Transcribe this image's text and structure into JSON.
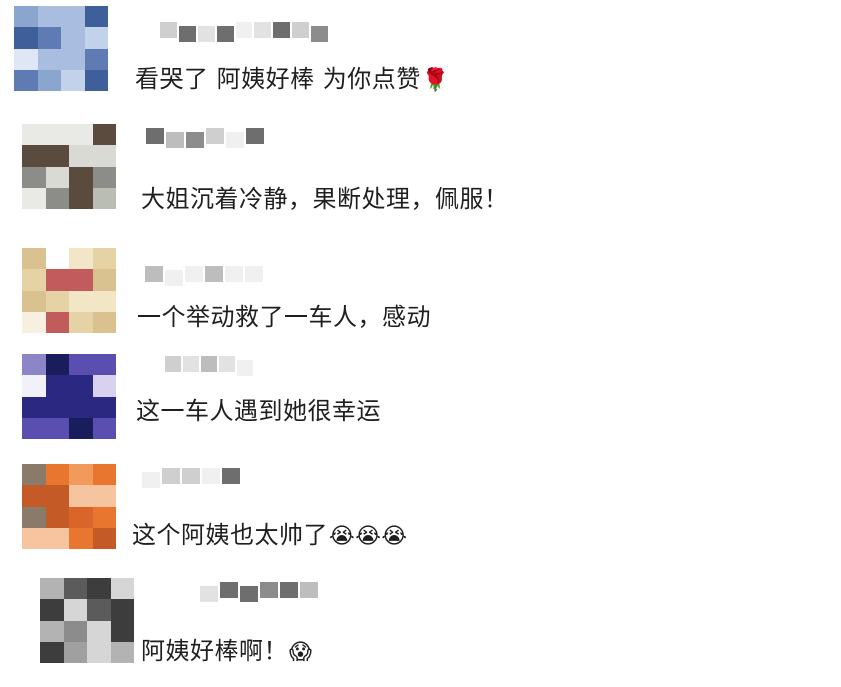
{
  "comments": [
    {
      "text": "看哭了 阿姨好棒 为你点赞",
      "emoji": "🌹",
      "emoji_icon": "rose-icon"
    },
    {
      "text": "大姐沉着冷静，果断处理，佩服！",
      "emoji": "",
      "emoji_icon": ""
    },
    {
      "text": "一个举动救了一车人，感动",
      "emoji": "",
      "emoji_icon": ""
    },
    {
      "text": "这一车人遇到她很幸运",
      "emoji": "",
      "emoji_icon": ""
    },
    {
      "text": "这个阿姨也太帅了",
      "emoji": "😭😭😭",
      "emoji_icon": "loudly-crying-face-icon"
    },
    {
      "text": "阿姨好棒啊！",
      "emoji": "😱",
      "emoji_icon": "screaming-face-icon"
    }
  ],
  "avatar_palettes": [
    [
      "#8aa6cf",
      "#5e7cb3",
      "#c2d2ea",
      "#3f5f9a",
      "#a9bde0",
      "#dfe7f4"
    ],
    [
      "#d9dad3",
      "#b9bdb3",
      "#5b4a3e",
      "#3a3a3a",
      "#8c8c88",
      "#e9eae6"
    ],
    [
      "#f3e6c7",
      "#e6d3a5",
      "#c25b5b",
      "#f7efe0",
      "#d9c28f",
      "#ffffff"
    ],
    [
      "#1a1d5c",
      "#5a4fb0",
      "#d9d2ee",
      "#2a2880",
      "#8c86c8",
      "#f2f0f8"
    ],
    [
      "#e9762f",
      "#d9652a",
      "#f29a5b",
      "#8a7a6a",
      "#c45a25",
      "#f7c4a0"
    ],
    [
      "#8c8c8c",
      "#5b5b5b",
      "#b3b3b3",
      "#3d3d3d",
      "#a0a0a0",
      "#d6d6d6"
    ]
  ]
}
